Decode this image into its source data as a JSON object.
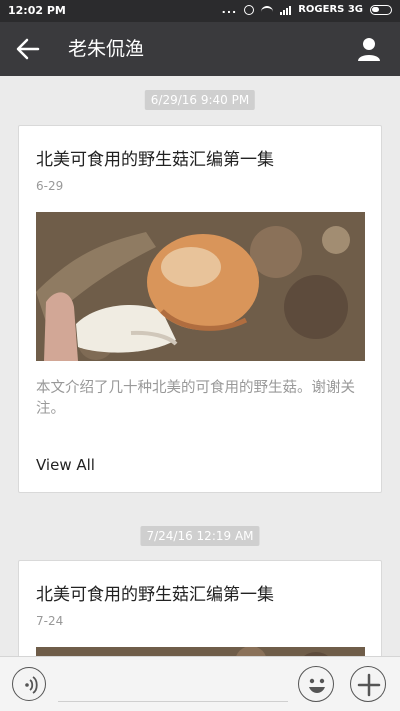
{
  "status_bar": {
    "time": "12:02 PM",
    "dots": "...",
    "carrier": "ROGERS 3G",
    "icons": [
      "alarm-icon",
      "wifi-icon",
      "signal-icon",
      "battery-icon"
    ]
  },
  "header": {
    "title": "老朱侃渔",
    "back_icon": "arrow-left-icon",
    "profile_icon": "person-icon"
  },
  "messages": [
    {
      "timestamp": "6/29/16 9:40 PM",
      "title": "北美可食用的野生菇汇编第一集",
      "date": "6-29",
      "description": "本文介绍了几十种北美的可食用的野生菇。谢谢关注。",
      "link": "View All"
    },
    {
      "timestamp": "7/24/16 12:19 AM",
      "title": "北美可食用的野生菇汇编第一集",
      "date": "7-24"
    }
  ],
  "bottom_bar": {
    "voice_icon": "voice-icon",
    "emoji_icon": "emoji-icon",
    "plus_icon": "plus-icon"
  },
  "colors": {
    "header_bg": "#3a3a3d",
    "status_bg": "#2b2b2d",
    "content_bg": "#ebebeb",
    "timestamp_bg": "#cfcfcf"
  }
}
